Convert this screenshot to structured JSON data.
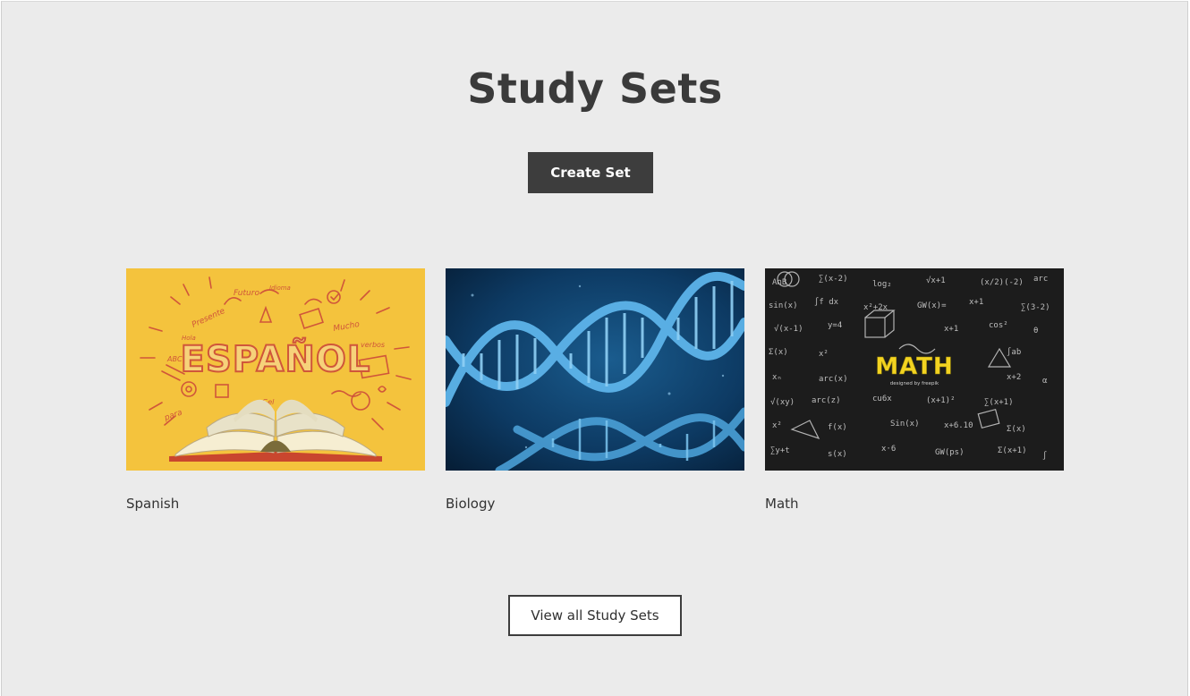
{
  "header": {
    "title": "Study Sets",
    "create_label": "Create Set"
  },
  "study_sets": [
    {
      "label": "Spanish",
      "image_icon": "spanish-book-illustration",
      "image_text": "ESPAÑOL",
      "image_doodles": [
        "Futuro",
        "Idioma",
        "Presente",
        "Mucho",
        "verbos",
        "ABC",
        "Hola",
        "para",
        "Gel"
      ],
      "bg_color": "#f4c33d",
      "accent_color": "#d0563a"
    },
    {
      "label": "Biology",
      "image_icon": "dna-helix-photo",
      "bg_color": "#0b2f52",
      "accent_color": "#4fa6dd"
    },
    {
      "label": "Math",
      "image_icon": "chalkboard-math-illustration",
      "image_text": "MATH",
      "image_credit": "designed by freepik",
      "bg_color": "#1a1a1a",
      "accent_color": "#f3d321"
    }
  ],
  "footer": {
    "view_all_label": "View all Study Sets"
  }
}
